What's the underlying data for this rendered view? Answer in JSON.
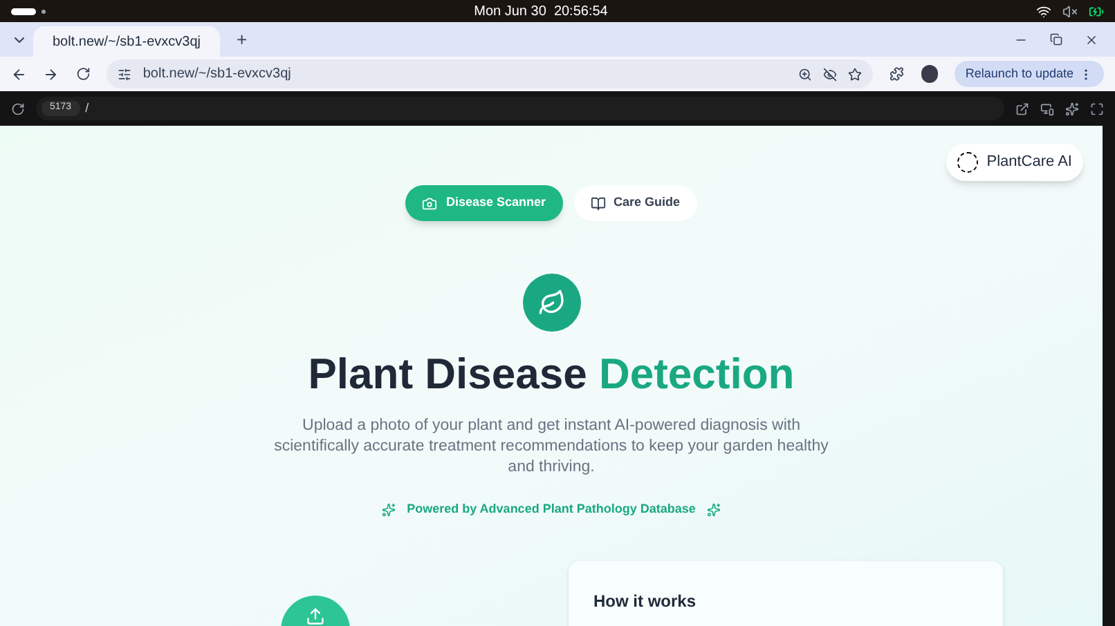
{
  "system_bar": {
    "clock": "Mon Jun 30  20:56:54"
  },
  "browser": {
    "tabs": [
      {
        "title": "bolt.new/~/sb1-evxcv3qj",
        "selected": true
      }
    ],
    "new_tab": "+",
    "address": "bolt.new/~/sb1-evxcv3qj",
    "relaunch": "Relaunch to update"
  },
  "preview_bar": {
    "port": "5173",
    "path": "/"
  },
  "page": {
    "badge": "PlantCare AI",
    "nav": [
      {
        "label": "Disease Scanner",
        "kind": "camera",
        "selected": true
      },
      {
        "label": "Care Guide",
        "kind": "book",
        "selected": false
      }
    ],
    "title": {
      "main": "Plant Disease",
      "accent": "Detection"
    },
    "description": "Upload a photo of your plant and get instant AI-powered diagnosis with scientifically accurate treatment recommendations to keep your garden healthy and thriving.",
    "powered": "Powered by Advanced Plant Pathology Database",
    "card": {
      "title": "How it works"
    }
  }
}
